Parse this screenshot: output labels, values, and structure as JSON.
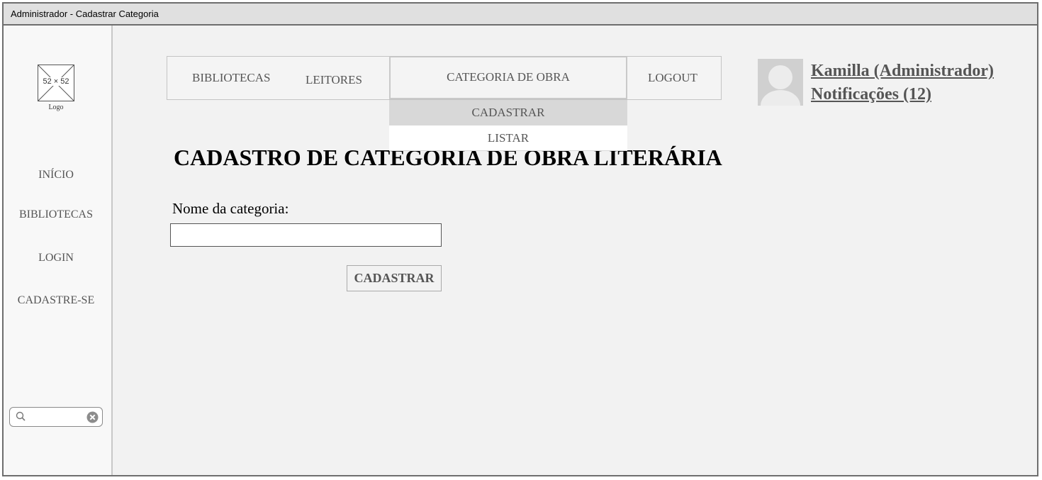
{
  "window": {
    "title": "Administrador - Cadastrar Categoria"
  },
  "sidebar": {
    "logo": {
      "dimensions": "52 × 52",
      "caption": "Logo"
    },
    "items": [
      {
        "label": "INÍCIO"
      },
      {
        "label": "BIBLIOTECAS"
      },
      {
        "label": "LOGIN"
      },
      {
        "label": "CADASTRE-SE"
      }
    ],
    "search": {
      "value": "",
      "icon": "search-icon",
      "clear_icon": "clear-icon"
    }
  },
  "topnav": {
    "items": [
      {
        "label": "BIBLIOTECAS"
      },
      {
        "label": "LEITORES"
      },
      {
        "label": "CATEGORIA DE OBRA"
      },
      {
        "label": "LOGOUT"
      }
    ],
    "dropdown": [
      {
        "label": "CADASTRAR"
      },
      {
        "label": "LISTAR"
      }
    ]
  },
  "user": {
    "name": "Kamilla (Administrador)",
    "notifications": "Notificações (12)",
    "avatar_icon": "avatar-icon"
  },
  "form": {
    "title": "CADASTRO DE CATEGORIA DE OBRA LITERÁRIA",
    "label": "Nome da categoria:",
    "value": "",
    "submit_label": "CADASTRAR"
  },
  "colors": {
    "window_border": "#6e6e6e",
    "titlebar_bg": "#e0e0e0",
    "content_bg": "#f2f2f2",
    "selected_bg": "#d8d8d8",
    "text_muted": "#555555"
  }
}
